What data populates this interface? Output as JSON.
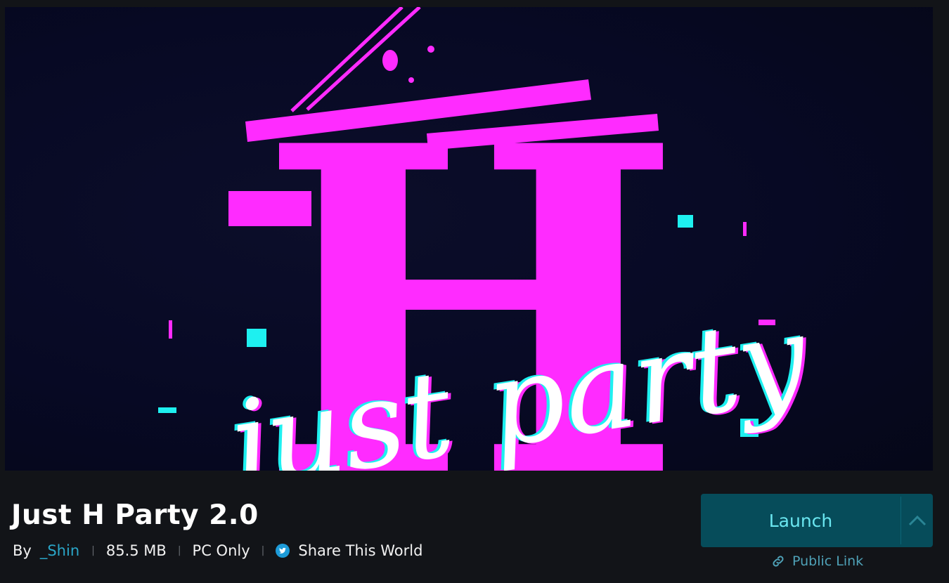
{
  "world": {
    "title": "Just H Party 2.0",
    "by_label": "By",
    "author": "_Shin",
    "size": "85.5 MB",
    "platform": "PC Only",
    "share_label": "Share This World"
  },
  "hero": {
    "logo_letter": "H",
    "logo_script": "just party"
  },
  "actions": {
    "launch_label": "Launch",
    "public_link_label": "Public Link"
  },
  "colors": {
    "background": "#121418",
    "accent_teal": "#064c5a",
    "launch_text": "#6ae6f0",
    "author_link": "#2aa6c8",
    "logo_magenta": "#ff2bff",
    "logo_cyan": "#1ef0f0"
  },
  "icons": {
    "twitter": "twitter-bird-icon",
    "link": "chain-link-icon",
    "expand": "chevron-up-icon"
  }
}
